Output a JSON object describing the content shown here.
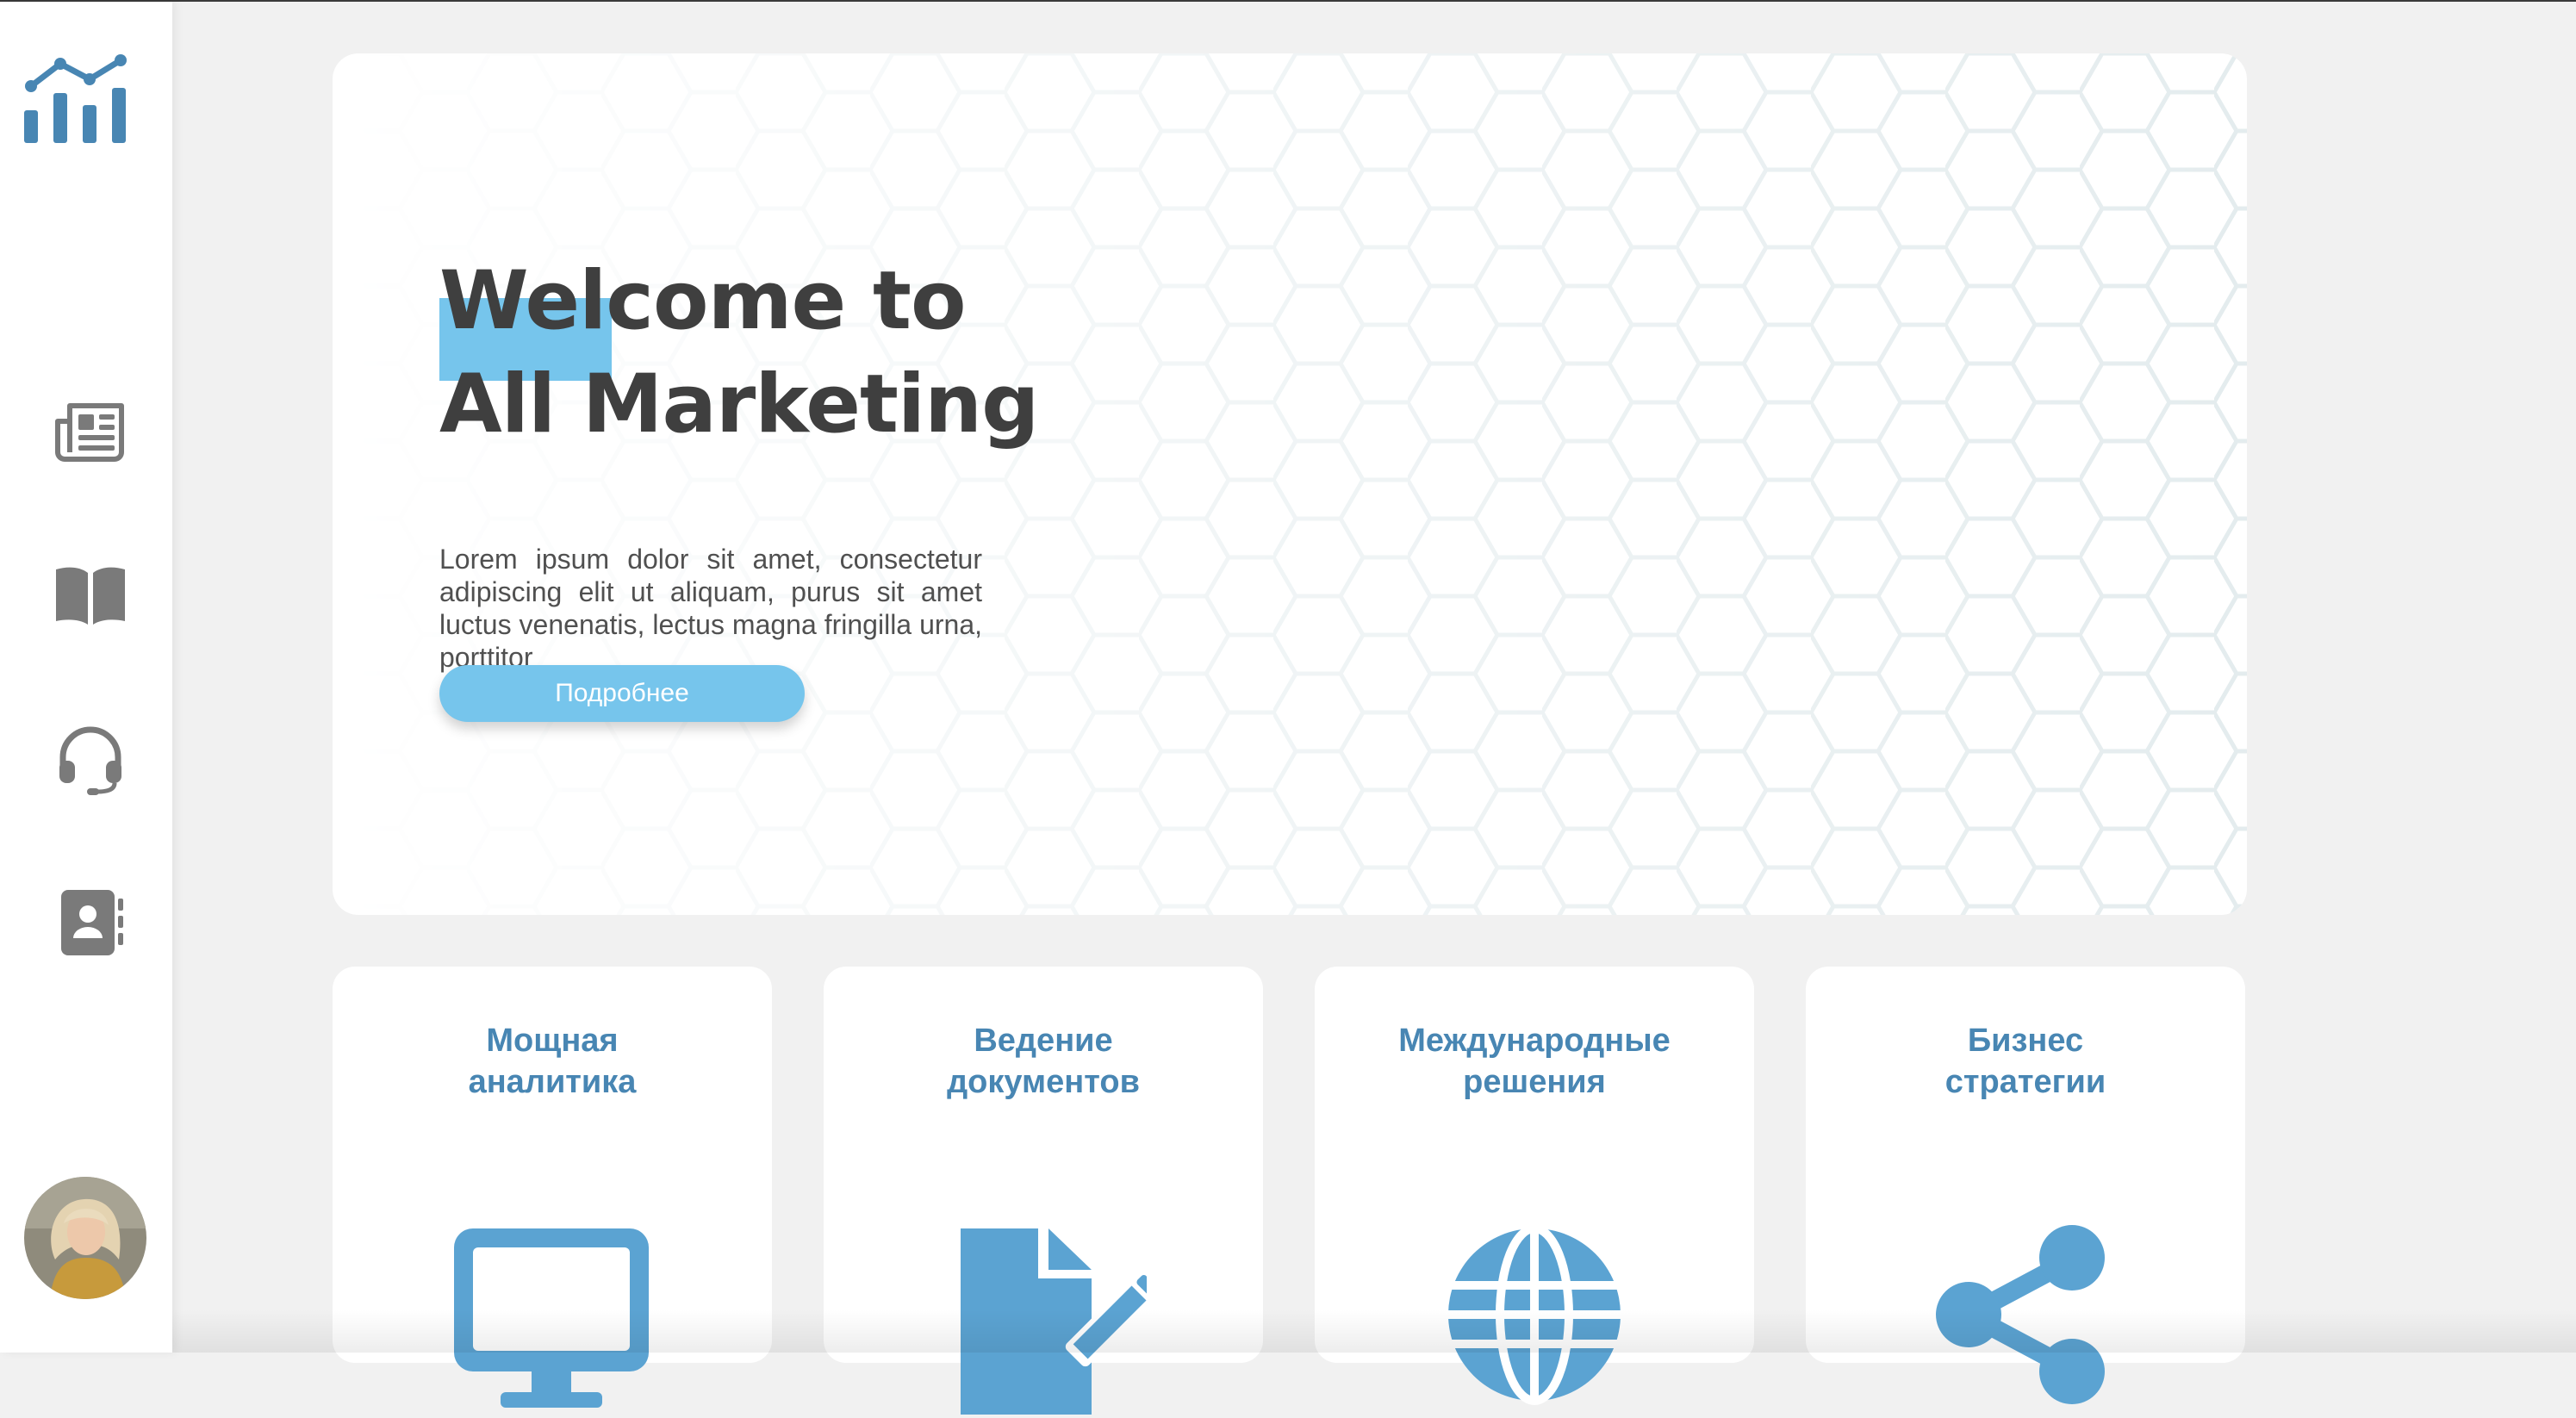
{
  "colors": {
    "accent": "#76c5ec",
    "brand_blue": "#4886b3",
    "icon_blue": "#5ba3d2",
    "nav_icon_gray": "#7a7a7a",
    "title_text": "#3f3f3f",
    "background": "#f1f1f1"
  },
  "sidebar": {
    "logo_icon": "analytics-chart-icon",
    "items": [
      {
        "icon": "newspaper-icon"
      },
      {
        "icon": "book-icon"
      },
      {
        "icon": "headset-icon"
      },
      {
        "icon": "contacts-book-icon"
      }
    ],
    "avatar_icon": "user-avatar"
  },
  "hero": {
    "title_line1": "Welcome to",
    "title_line2": "All Marketing",
    "text": "Lorem ipsum dolor sit amet, consectetur adipiscing elit ut aliquam, purus sit amet luctus venenatis, lectus magna fringilla urna, porttitor",
    "button_label": "Подробнее"
  },
  "cards": [
    {
      "title_line1": "Мощная",
      "title_line2": "аналитика",
      "icon": "monitor-icon"
    },
    {
      "title_line1": "Ведение",
      "title_line2": "документов",
      "icon": "document-edit-icon"
    },
    {
      "title_line1": "Международные",
      "title_line2": "решения",
      "icon": "globe-icon"
    },
    {
      "title_line1": "Бизнес",
      "title_line2": "стратегии",
      "icon": "share-icon"
    }
  ]
}
